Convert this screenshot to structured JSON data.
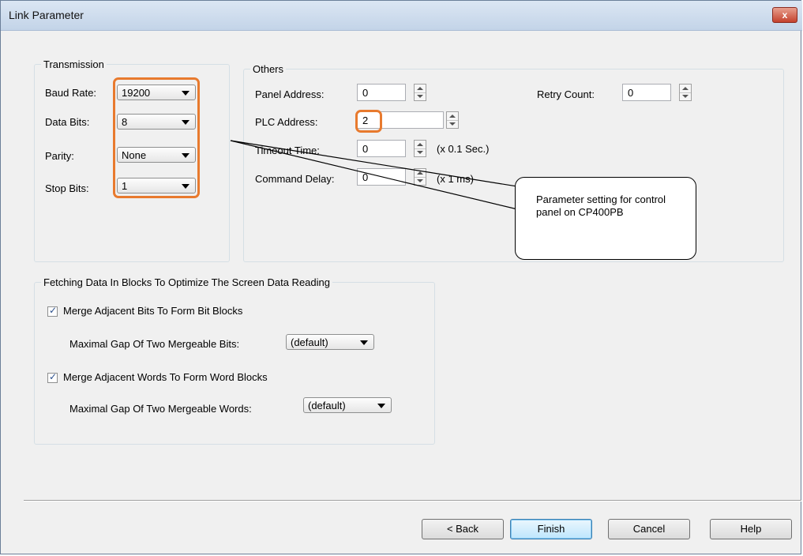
{
  "window": {
    "title": "Link Parameter",
    "close_label": "x"
  },
  "transmission": {
    "legend": "Transmission",
    "fields": [
      {
        "label": "Baud Rate:",
        "value": "19200"
      },
      {
        "label": "Data Bits:",
        "value": "8"
      },
      {
        "label": "Parity:",
        "value": "None"
      },
      {
        "label": "Stop Bits:",
        "value": "1"
      }
    ]
  },
  "others": {
    "legend": "Others",
    "panel_address": {
      "label": "Panel Address:",
      "value": "0"
    },
    "plc_address": {
      "label": "PLC Address:",
      "value": "2"
    },
    "timeout_time": {
      "label": "Timeout Time:",
      "value": "0",
      "unit": "(x 0.1 Sec.)"
    },
    "command_delay": {
      "label": "Command Delay:",
      "value": "0",
      "unit": "(x 1 ms)"
    },
    "retry_count": {
      "label": "Retry Count:",
      "value": "0"
    }
  },
  "fetching": {
    "legend": "Fetching Data In Blocks To Optimize The Screen Data Reading",
    "merge_bits": {
      "label": "Merge Adjacent Bits To Form Bit Blocks",
      "checked": true
    },
    "gap_bits": {
      "label": "Maximal Gap Of Two Mergeable Bits:",
      "value": "(default)"
    },
    "merge_words": {
      "label": "Merge Adjacent Words To Form Word Blocks",
      "checked": true
    },
    "gap_words": {
      "label": "Maximal Gap Of Two Mergeable Words:",
      "value": "(default)"
    }
  },
  "buttons": {
    "back": "< Back",
    "finish": "Finish",
    "cancel": "Cancel",
    "help": "Help"
  },
  "callout": {
    "text": "Parameter setting for control panel on CP400PB"
  },
  "colors": {
    "highlight": "#e87a2e",
    "titlebar": "#c3d4e8"
  }
}
